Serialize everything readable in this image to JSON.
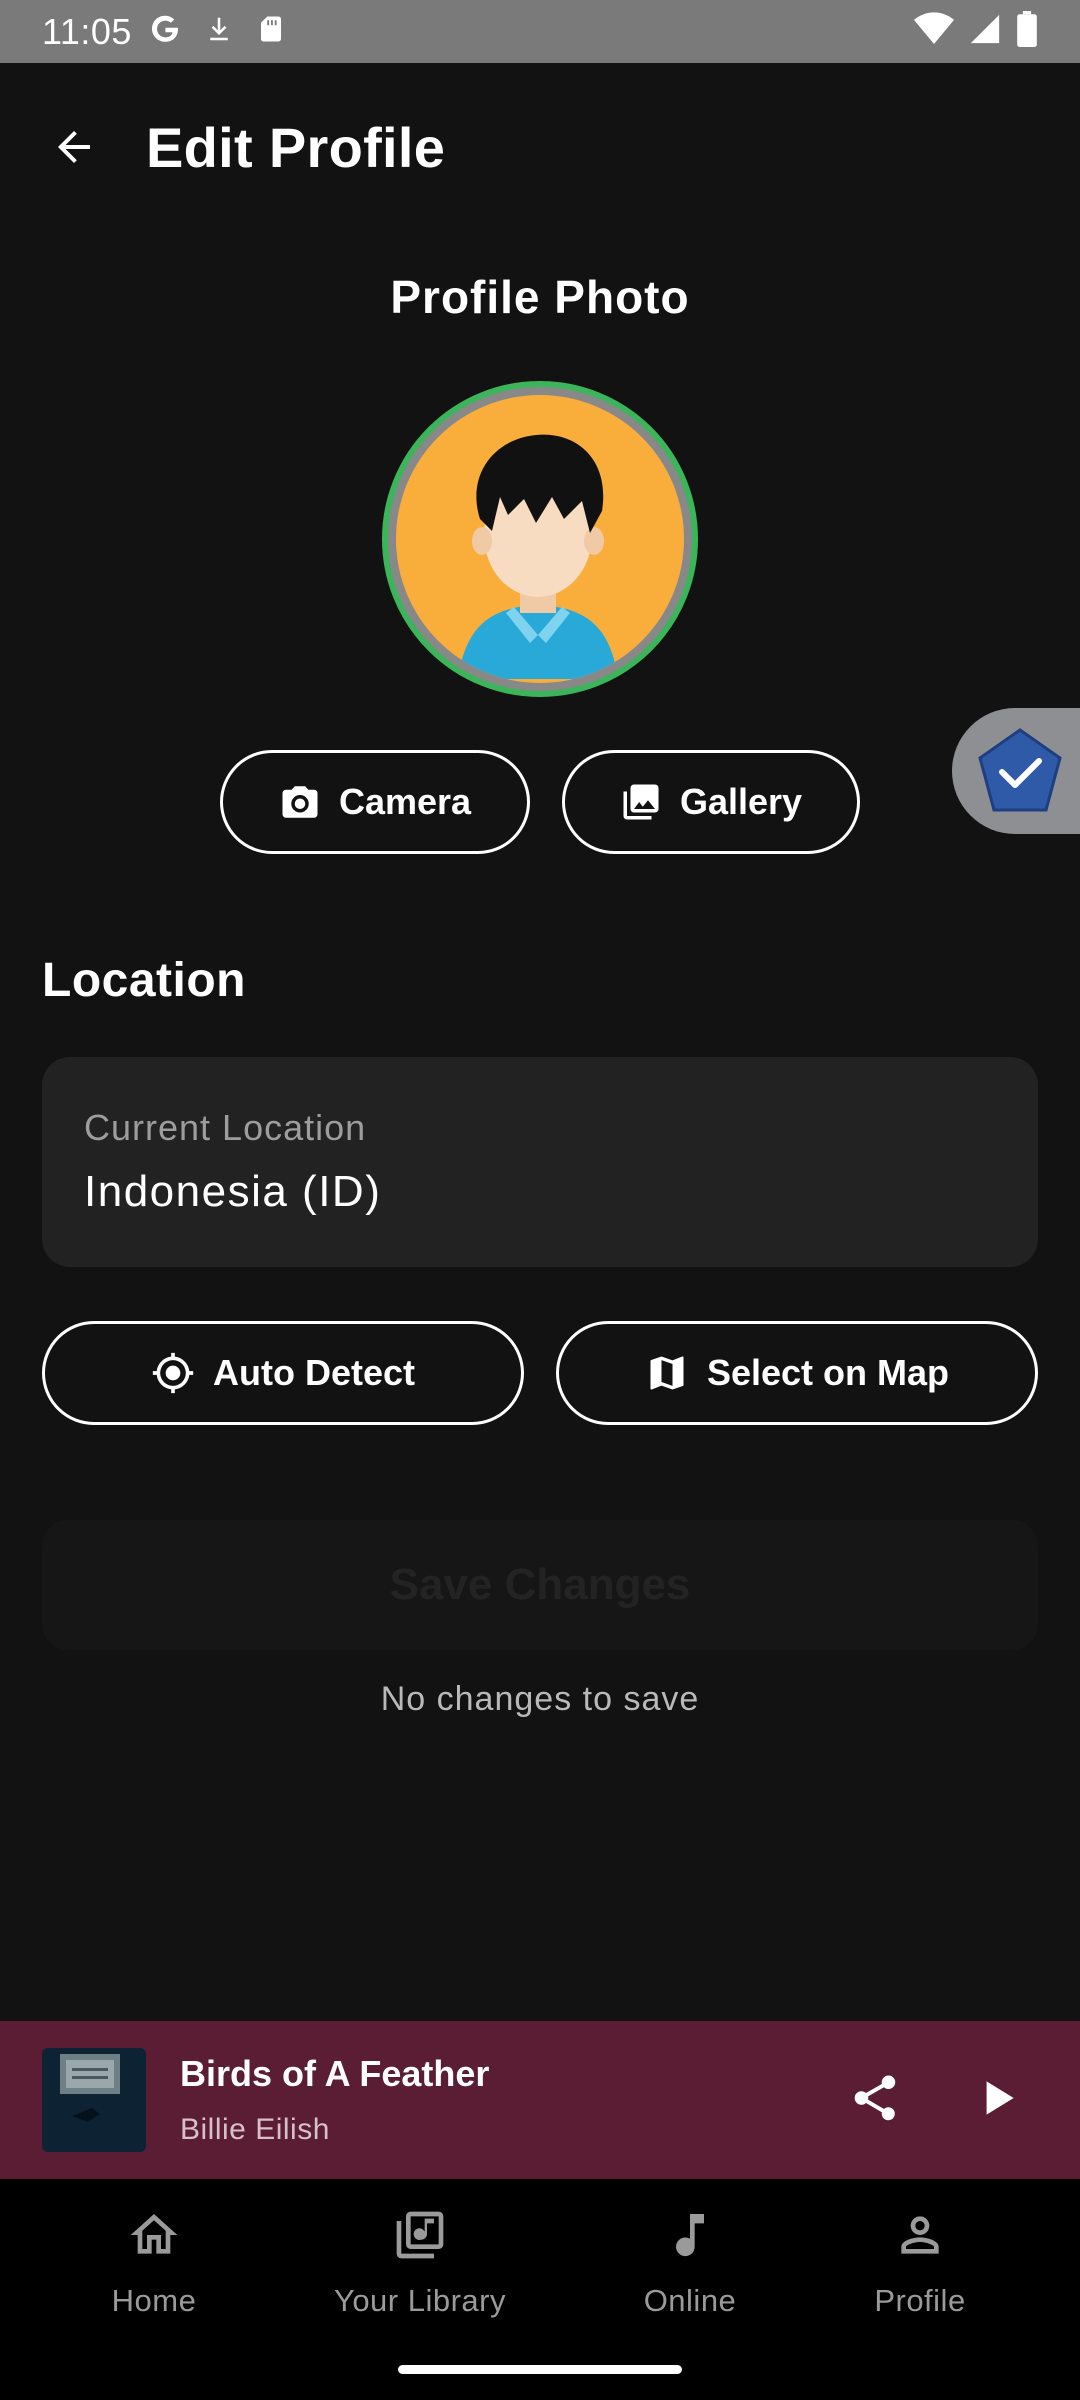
{
  "status_bar": {
    "time": "11:05",
    "left_icons": [
      "google-icon",
      "download-icon",
      "sd-card-icon"
    ],
    "right_icons": [
      "wifi-icon",
      "signal-icon",
      "battery-icon"
    ]
  },
  "header": {
    "title": "Edit Profile"
  },
  "profile_photo": {
    "heading": "Profile Photo",
    "avatar_ring_color": "#3cb55a",
    "avatar_bg_color": "#f9ae3b",
    "camera_label": "Camera",
    "gallery_label": "Gallery"
  },
  "location": {
    "heading": "Location",
    "field_label": "Current Location",
    "field_value": "Indonesia (ID)",
    "auto_detect_label": "Auto Detect",
    "select_on_map_label": "Select on Map"
  },
  "save": {
    "label": "Save Changes",
    "hint": "No changes to save"
  },
  "mini_player": {
    "title": "Birds of A Feather",
    "artist": "Billie Eilish",
    "background_color": "#5a1d33"
  },
  "bottom_nav": {
    "items": [
      {
        "label": "Home",
        "icon": "home-icon"
      },
      {
        "label": "Your Library",
        "icon": "library-icon"
      },
      {
        "label": "Online",
        "icon": "music-note-icon"
      },
      {
        "label": "Profile",
        "icon": "person-icon"
      }
    ]
  }
}
